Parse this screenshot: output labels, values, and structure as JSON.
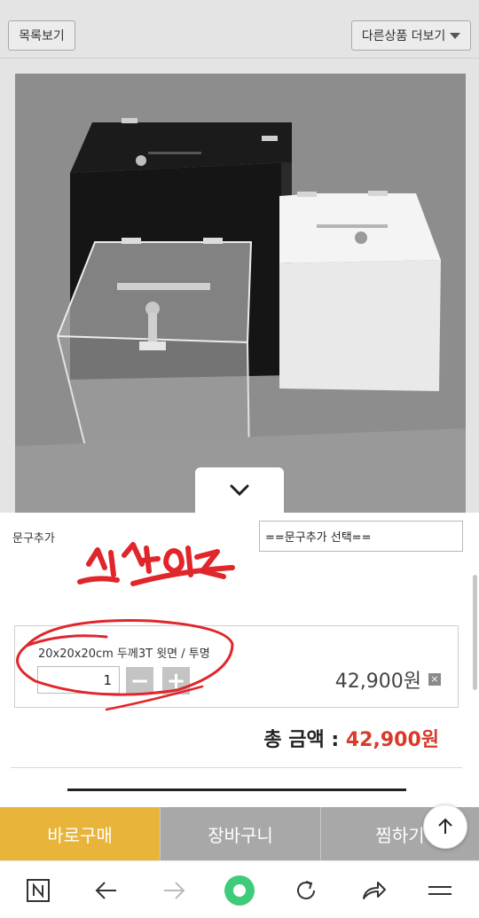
{
  "header": {
    "list_button": "목록보기",
    "more_products_button": "다른상품 더보기"
  },
  "option": {
    "label": "문구추가",
    "select_value": "==문구추가 선택=="
  },
  "selected_item": {
    "name": "20x20x20cm 두께3T 윗면 / 투명",
    "quantity": "1",
    "minus": "−",
    "plus": "+",
    "price": "42,900원",
    "remove": "×"
  },
  "total": {
    "label": "총 금액 : ",
    "price": "42,900원"
  },
  "actions": {
    "buy_now": "바로구매",
    "cart": "장바구니",
    "wishlist": "찜하기"
  },
  "annotation": {
    "handwritten_text": "실사이즈",
    "color": "#e0262b"
  },
  "colors": {
    "buy_button": "#e8b53a",
    "secondary_button": "#a8a8a8",
    "total_price": "#d93a2b",
    "browser_home": "#3ecb7a"
  },
  "icons": {
    "collapse": "chevron-down-icon",
    "to_top": "arrow-up-icon",
    "browser_home": "naver-n-icon",
    "back": "arrow-left-icon",
    "forward": "arrow-right-icon",
    "green_dot": "green-circle-icon",
    "refresh": "refresh-icon",
    "share": "share-icon",
    "menu": "menu-icon"
  }
}
